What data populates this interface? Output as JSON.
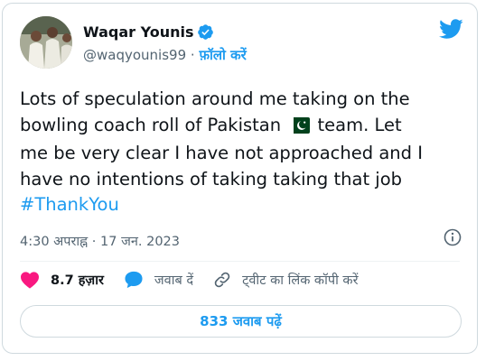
{
  "tweet": {
    "author_name": "Waqar Younis",
    "handle": "@waqyounis99",
    "separator": " · ",
    "follow_label": "फ़ॉलो करें",
    "text_line1": "Lots of speculation around me taking on the",
    "text_line2_pre": "bowling coach roll of Pakistan",
    "text_line2_post": "team. Let",
    "text_line3": "me be very clear I have not approached and I",
    "text_line4": "have no intentions of taking taking that job",
    "hashtag": "#ThankYou",
    "timestamp": "4:30 अपराह्न · 17 जन. 2023",
    "likes": "8.7 हज़ार",
    "reply_label": "जवाब दें",
    "copy_link_label": "ट्वीट का लिंक कॉपी करें",
    "read_replies_label": "833 जवाब पढ़ें"
  },
  "icons": {
    "verified": "verified-badge-icon",
    "brand": "twitter-bird-icon",
    "info": "info-icon",
    "like": "heart-icon",
    "reply": "reply-bubble-icon",
    "link": "link-icon",
    "flag": "pakistan-flag-emoji"
  },
  "colors": {
    "accent": "#1d9bf0",
    "like": "#f91880",
    "text": "#0f1419",
    "muted": "#536471"
  }
}
